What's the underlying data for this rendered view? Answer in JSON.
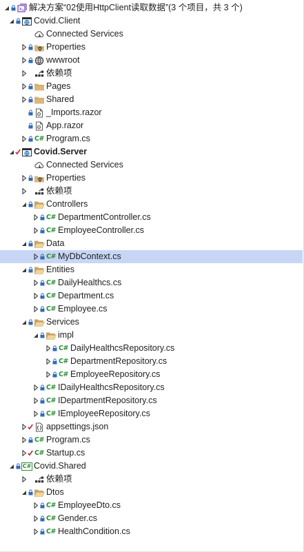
{
  "solution_explorer": {
    "items": [
      {
        "label": "解决方案“02使用HttpClient读取数据”(3 个项目，共 3 个)",
        "level": 0,
        "expander": "expanded",
        "icon": "solution-icon",
        "lock": true,
        "check": false,
        "bold": false
      },
      {
        "label": "Covid.Client",
        "level": 1,
        "expander": "expanded",
        "icon": "web-project-icon",
        "lock": true,
        "check": false,
        "bold": false
      },
      {
        "label": "Connected Services",
        "level": 2,
        "expander": "none",
        "icon": "connected-services-icon",
        "lock": false,
        "check": false,
        "bold": false
      },
      {
        "label": "Properties",
        "level": 2,
        "expander": "collapsed",
        "icon": "properties-icon",
        "lock": true,
        "check": false,
        "bold": false
      },
      {
        "label": "wwwroot",
        "level": 2,
        "expander": "collapsed",
        "icon": "globe-icon",
        "lock": true,
        "check": false,
        "bold": false
      },
      {
        "label": "依赖项",
        "level": 2,
        "expander": "collapsed",
        "icon": "dependencies-icon",
        "lock": false,
        "check": false,
        "bold": false
      },
      {
        "label": "Pages",
        "level": 2,
        "expander": "collapsed",
        "icon": "folder-icon",
        "lock": true,
        "check": false,
        "bold": false
      },
      {
        "label": "Shared",
        "level": 2,
        "expander": "collapsed",
        "icon": "folder-icon",
        "lock": true,
        "check": false,
        "bold": false
      },
      {
        "label": "_Imports.razor",
        "level": 2,
        "expander": "none",
        "icon": "razor-file-icon",
        "lock": true,
        "check": false,
        "bold": false
      },
      {
        "label": "App.razor",
        "level": 2,
        "expander": "none",
        "icon": "razor-file-icon",
        "lock": true,
        "check": false,
        "bold": false
      },
      {
        "label": "Program.cs",
        "level": 2,
        "expander": "collapsed",
        "icon": "csharp-file-icon",
        "lock": true,
        "check": false,
        "bold": false
      },
      {
        "label": "Covid.Server",
        "level": 1,
        "expander": "expanded",
        "icon": "web-project-icon",
        "lock": false,
        "check": true,
        "bold": true
      },
      {
        "label": "Connected Services",
        "level": 2,
        "expander": "none",
        "icon": "connected-services-icon",
        "lock": false,
        "check": false,
        "bold": false
      },
      {
        "label": "Properties",
        "level": 2,
        "expander": "collapsed",
        "icon": "properties-icon",
        "lock": true,
        "check": false,
        "bold": false
      },
      {
        "label": "依赖项",
        "level": 2,
        "expander": "collapsed",
        "icon": "dependencies-icon",
        "lock": false,
        "check": false,
        "bold": false
      },
      {
        "label": "Controllers",
        "level": 2,
        "expander": "expanded",
        "icon": "folder-open-icon",
        "lock": true,
        "check": false,
        "bold": false
      },
      {
        "label": "DepartmentController.cs",
        "level": 3,
        "expander": "collapsed",
        "icon": "csharp-file-icon",
        "lock": true,
        "check": false,
        "bold": false
      },
      {
        "label": "EmployeeController.cs",
        "level": 3,
        "expander": "collapsed",
        "icon": "csharp-file-icon",
        "lock": true,
        "check": false,
        "bold": false
      },
      {
        "label": "Data",
        "level": 2,
        "expander": "expanded",
        "icon": "folder-open-icon",
        "lock": true,
        "check": false,
        "bold": false
      },
      {
        "label": "MyDbContext.cs",
        "level": 3,
        "expander": "collapsed",
        "icon": "csharp-file-icon",
        "lock": true,
        "check": false,
        "bold": false,
        "selected": true
      },
      {
        "label": "Entities",
        "level": 2,
        "expander": "expanded",
        "icon": "folder-open-icon",
        "lock": true,
        "check": false,
        "bold": false
      },
      {
        "label": "DailyHealthcs.cs",
        "level": 3,
        "expander": "collapsed",
        "icon": "csharp-file-icon",
        "lock": true,
        "check": false,
        "bold": false
      },
      {
        "label": "Department.cs",
        "level": 3,
        "expander": "collapsed",
        "icon": "csharp-file-icon",
        "lock": true,
        "check": false,
        "bold": false
      },
      {
        "label": "Employee.cs",
        "level": 3,
        "expander": "collapsed",
        "icon": "csharp-file-icon",
        "lock": true,
        "check": false,
        "bold": false
      },
      {
        "label": "Services",
        "level": 2,
        "expander": "expanded",
        "icon": "folder-open-icon",
        "lock": true,
        "check": false,
        "bold": false
      },
      {
        "label": "impl",
        "level": 3,
        "expander": "expanded",
        "icon": "folder-open-icon",
        "lock": true,
        "check": false,
        "bold": false
      },
      {
        "label": "DailyHealthcsRepository.cs",
        "level": 4,
        "expander": "collapsed",
        "icon": "csharp-file-icon",
        "lock": true,
        "check": false,
        "bold": false
      },
      {
        "label": "DepartmentRepository.cs",
        "level": 4,
        "expander": "collapsed",
        "icon": "csharp-file-icon",
        "lock": true,
        "check": false,
        "bold": false
      },
      {
        "label": "EmployeeRepository.cs",
        "level": 4,
        "expander": "collapsed",
        "icon": "csharp-file-icon",
        "lock": true,
        "check": false,
        "bold": false
      },
      {
        "label": "IDailyHealthcsRepository.cs",
        "level": 3,
        "expander": "collapsed",
        "icon": "csharp-file-icon",
        "lock": true,
        "check": false,
        "bold": false
      },
      {
        "label": "IDepartmentRepository.cs",
        "level": 3,
        "expander": "collapsed",
        "icon": "csharp-file-icon",
        "lock": true,
        "check": false,
        "bold": false
      },
      {
        "label": "IEmployeeRepository.cs",
        "level": 3,
        "expander": "collapsed",
        "icon": "csharp-file-icon",
        "lock": true,
        "check": false,
        "bold": false
      },
      {
        "label": "appsettings.json",
        "level": 2,
        "expander": "collapsed",
        "icon": "json-file-icon",
        "lock": false,
        "check": true,
        "bold": false
      },
      {
        "label": "Program.cs",
        "level": 2,
        "expander": "collapsed",
        "icon": "csharp-file-icon",
        "lock": true,
        "check": false,
        "bold": false
      },
      {
        "label": "Startup.cs",
        "level": 2,
        "expander": "collapsed",
        "icon": "csharp-file-icon",
        "lock": false,
        "check": true,
        "bold": false
      },
      {
        "label": "Covid.Shared",
        "level": 1,
        "expander": "expanded",
        "icon": "csharp-project-icon",
        "lock": true,
        "check": false,
        "bold": false
      },
      {
        "label": "依赖项",
        "level": 2,
        "expander": "collapsed",
        "icon": "dependencies-icon",
        "lock": false,
        "check": false,
        "bold": false
      },
      {
        "label": "Dtos",
        "level": 2,
        "expander": "expanded",
        "icon": "folder-open-icon",
        "lock": true,
        "check": false,
        "bold": false
      },
      {
        "label": "EmployeeDto.cs",
        "level": 3,
        "expander": "collapsed",
        "icon": "csharp-file-icon",
        "lock": true,
        "check": false,
        "bold": false
      },
      {
        "label": "Gender.cs",
        "level": 3,
        "expander": "collapsed",
        "icon": "csharp-file-icon",
        "lock": true,
        "check": false,
        "bold": false
      },
      {
        "label": "HealthCondition.cs",
        "level": 3,
        "expander": "collapsed",
        "icon": "csharp-file-icon",
        "lock": true,
        "check": false,
        "bold": false
      }
    ]
  },
  "colors": {
    "selection": "#c8d6f5",
    "lock": "#2f6cb8",
    "check": "#c2202c",
    "csharp": "#2c8d33",
    "folder": "#dcb67a"
  }
}
